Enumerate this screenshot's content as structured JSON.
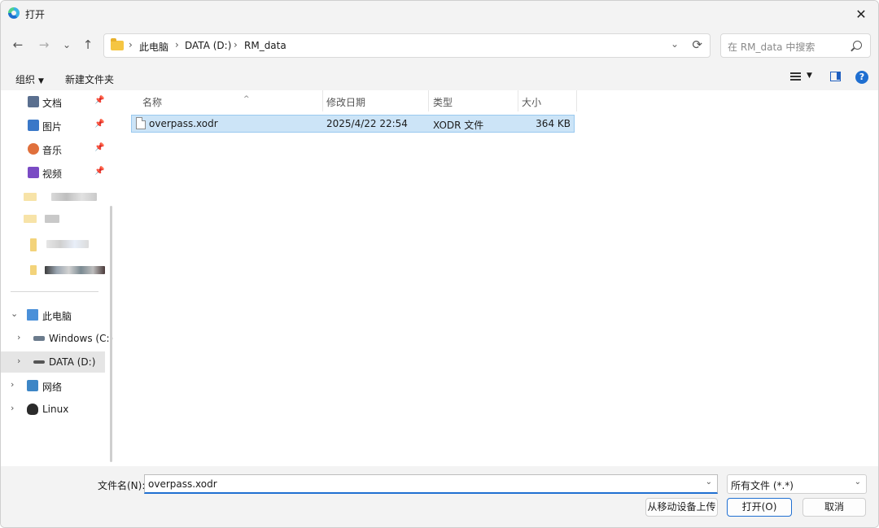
{
  "window": {
    "title": "打开",
    "close": "✕"
  },
  "nav": {
    "back": "←",
    "forward": "→",
    "recent": "⌄",
    "up": "↑",
    "breadcrumb": [
      "此电脑",
      "DATA (D:)",
      "RM_data"
    ],
    "sep": "›",
    "dropdown": "⌄",
    "refresh": "⟳",
    "search_placeholder": "在 RM_data 中搜索"
  },
  "command_bar": {
    "organize": "组织",
    "organize_caret": "▼",
    "new_folder": "新建文件夹",
    "view_caret": "▼",
    "help": "?"
  },
  "sidebar": {
    "quick_access": [
      {
        "label": "文档",
        "icon": "document-icon",
        "color": "#5a6f8f",
        "pin": "📌"
      },
      {
        "label": "图片",
        "icon": "pictures-icon",
        "color": "#3a78c8",
        "pin": "📌"
      },
      {
        "label": "音乐",
        "icon": "music-icon",
        "color": "#e0703c",
        "pin": "📌"
      },
      {
        "label": "视频",
        "icon": "video-icon",
        "color": "#7a4bc4",
        "pin": "📌"
      }
    ],
    "tree": [
      {
        "label": "此电脑",
        "chev": "⌄",
        "icon": "pc-icon"
      },
      {
        "label": "Windows (C:)",
        "chev": "›",
        "icon": "drive-c-icon"
      },
      {
        "label": "DATA (D:)",
        "chev": "›",
        "icon": "drive-d-icon",
        "selected": true
      },
      {
        "label": "网络",
        "chev": "›",
        "icon": "network-icon"
      },
      {
        "label": "Linux",
        "chev": "›",
        "icon": "linux-icon"
      }
    ]
  },
  "file_list": {
    "columns": [
      "名称",
      "修改日期",
      "类型",
      "大小"
    ],
    "sort_caret": "^",
    "rows": [
      {
        "name": "overpass.xodr",
        "modified": "2025/4/22 22:54",
        "type": "XODR 文件",
        "size": "364 KB"
      }
    ]
  },
  "bottom": {
    "filename_label": "文件名(N):",
    "filename_value": "overpass.xodr",
    "dropdown": "⌄",
    "filetype_value": "所有文件 (*.*)",
    "upload_button": "从移动设备上传",
    "open_button": "打开(O)",
    "cancel_button": "取消"
  },
  "colors": {
    "selection": "#cce4f7",
    "accent": "#1f6fd1",
    "chrome": "#f3f3f3"
  }
}
